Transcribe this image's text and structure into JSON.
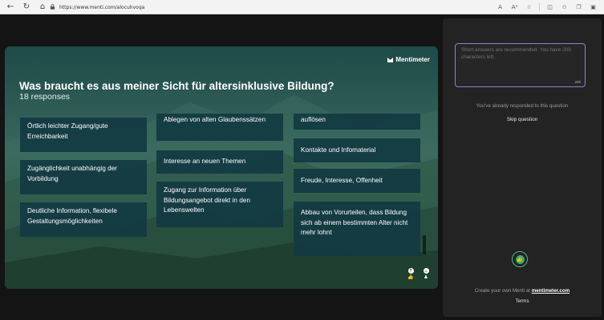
{
  "browser": {
    "url": "https://www.menti.com/alocuhvoqa",
    "reader_label": "A",
    "read_aloud_label": "Aᵃ"
  },
  "slide": {
    "brand": "Mentimeter",
    "question": "Was braucht es aus meiner Sicht für altersinklusive Bildung?",
    "responses": "18 responses",
    "cards": [
      "Örtlich leichter Zugang/gute Erreichbarkeit",
      "Zugänglichkeit unabhängig der Vorbildung",
      "Deutliche Information, flexibele Gestaltungsmöglichkeiten",
      "Ablegen von alten Glaubenssätzen",
      "Interesse an neuen Themen",
      "Zugang zur Information über Bildungsangebot direkt in den Lebenswelten",
      "auflösen",
      "Kontakte und Infomaterial",
      "Freude, Interesse, Offenheit",
      "Abbau von Vorurteilen, dass Bildung sich ab einem bestimmten Alter nicht mehr lohnt"
    ],
    "controls": {
      "help": "?",
      "reactions": "☺"
    }
  },
  "panel": {
    "answer_text": "Short answers are recommended. You have 200 characters left.",
    "char_count": "200",
    "responded": "You've already responded to this question",
    "skip": "Skip question",
    "create_prefix": "Create your own Menti at",
    "create_link": "mentimeter.com",
    "terms": "Terms"
  },
  "colors": {
    "accent": "#8b84d6",
    "card_bg": "#123a42",
    "like_green": "#3fa86d"
  }
}
